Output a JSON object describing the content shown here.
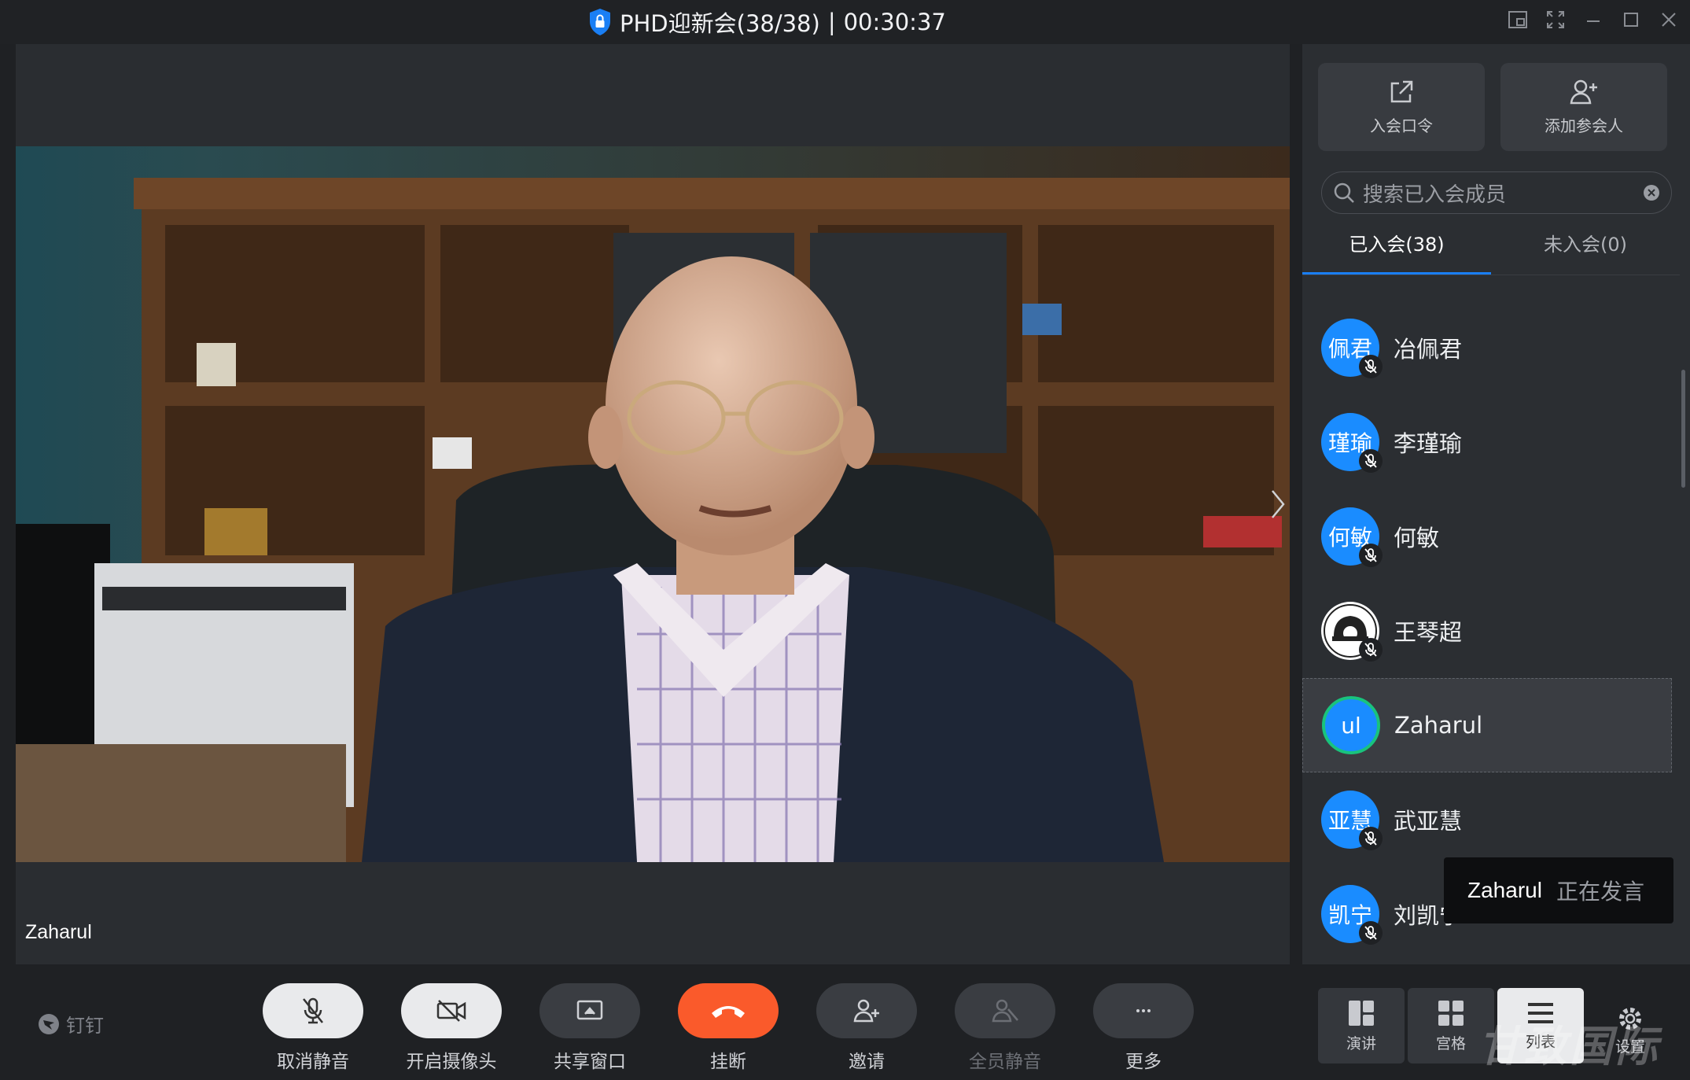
{
  "window": {
    "title": "PHD迎新会(38/38)",
    "timer": "00:30:37"
  },
  "stage": {
    "speaker_label": "Zaharul"
  },
  "panel": {
    "actions": [
      {
        "label": "入会口令",
        "icon": "share-out-icon"
      },
      {
        "label": "添加参会人",
        "icon": "add-person-icon"
      }
    ],
    "search_placeholder": "搜索已入会成员",
    "tabs": [
      {
        "label": "已入会(38)",
        "active": true
      },
      {
        "label": "未入会(0)",
        "active": false
      }
    ],
    "members": [
      {
        "avatar_text": "佩君",
        "name": "冶佩君",
        "muted": true
      },
      {
        "avatar_text": "瑾瑜",
        "name": "李瑾瑜",
        "muted": true
      },
      {
        "avatar_text": "何敏",
        "name": "何敏",
        "muted": true
      },
      {
        "avatar_text": "",
        "name": "王琴超",
        "muted": true
      },
      {
        "avatar_text": "ul",
        "name": "Zaharul",
        "muted": false,
        "speaking": true
      },
      {
        "avatar_text": "亚慧",
        "name": "武亚慧",
        "muted": true
      },
      {
        "avatar_text": "凯宁",
        "name": "刘凯宁",
        "muted": true
      }
    ],
    "toast": {
      "who": "Zaharul",
      "status": "正在发言"
    }
  },
  "toolbar": {
    "brand": "钉钉",
    "buttons": [
      {
        "label": "取消静音",
        "icon": "mic-muted-icon"
      },
      {
        "label": "开启摄像头",
        "icon": "camera-off-icon"
      },
      {
        "label": "共享窗口",
        "icon": "share-screen-icon"
      },
      {
        "label": "挂断",
        "icon": "hang-up-icon"
      },
      {
        "label": "邀请",
        "icon": "invite-icon"
      },
      {
        "label": "全员静音",
        "icon": "mute-all-icon"
      },
      {
        "label": "更多",
        "icon": "more-icon"
      }
    ],
    "view_modes": [
      {
        "label": "演讲",
        "icon": "speaker-view-icon"
      },
      {
        "label": "宫格",
        "icon": "grid-view-icon"
      },
      {
        "label": "列表",
        "icon": "list-view-icon",
        "active": true
      }
    ],
    "settings_label": "设置",
    "watermark": "甘致国际"
  },
  "colors": {
    "accent": "#1a7ff5",
    "hangup": "#fa5a2b",
    "speaking": "#19c37d",
    "avatar": "#1a8cff"
  }
}
